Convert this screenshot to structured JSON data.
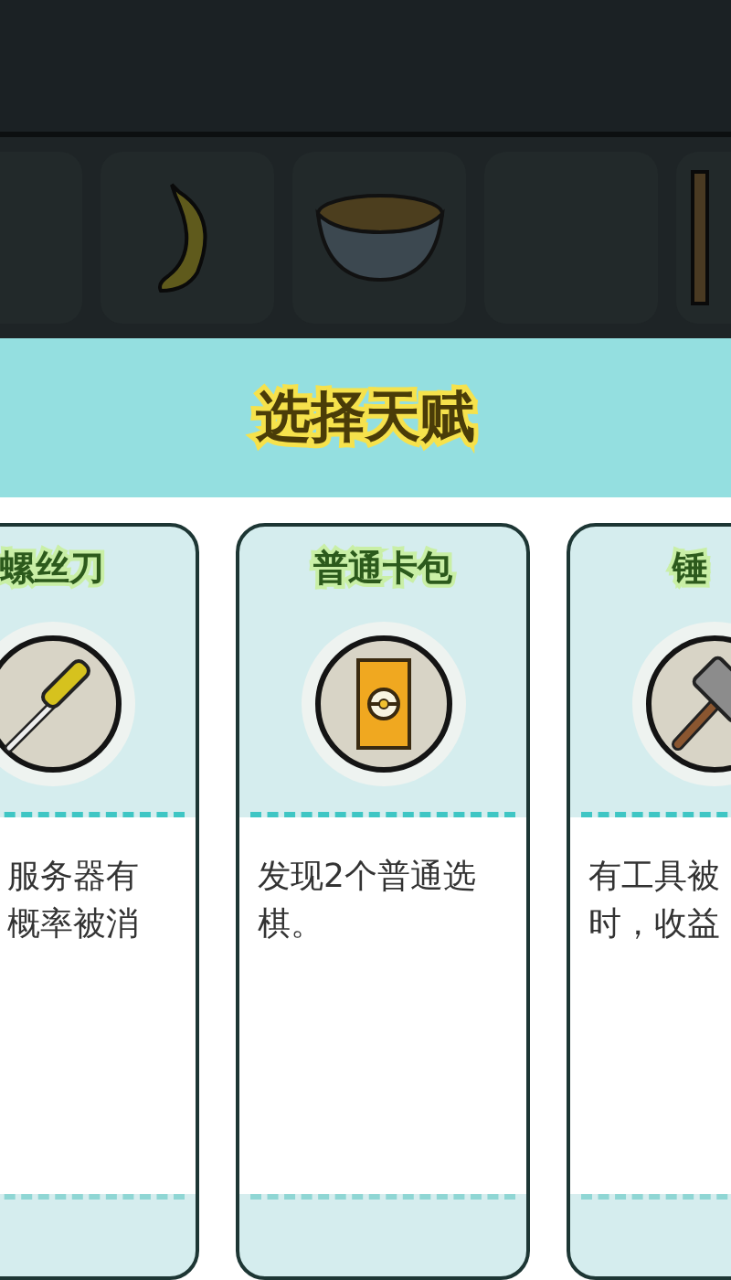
{
  "inventory": [
    {
      "kind": "empty"
    },
    {
      "kind": "banana"
    },
    {
      "kind": "bowl"
    },
    {
      "kind": "empty"
    },
    {
      "kind": "stick"
    }
  ],
  "dialog": {
    "title": "选择天赋",
    "cards": [
      {
        "title": "螺丝刀",
        "kind": "screwdriver",
        "description": "服务器有概率被消"
      },
      {
        "title": "普通卡包",
        "kind": "card-pack",
        "description": "发现2个普通选棋。"
      },
      {
        "title": "锤",
        "kind": "hammer",
        "description": "有工具被时，收益"
      }
    ]
  }
}
